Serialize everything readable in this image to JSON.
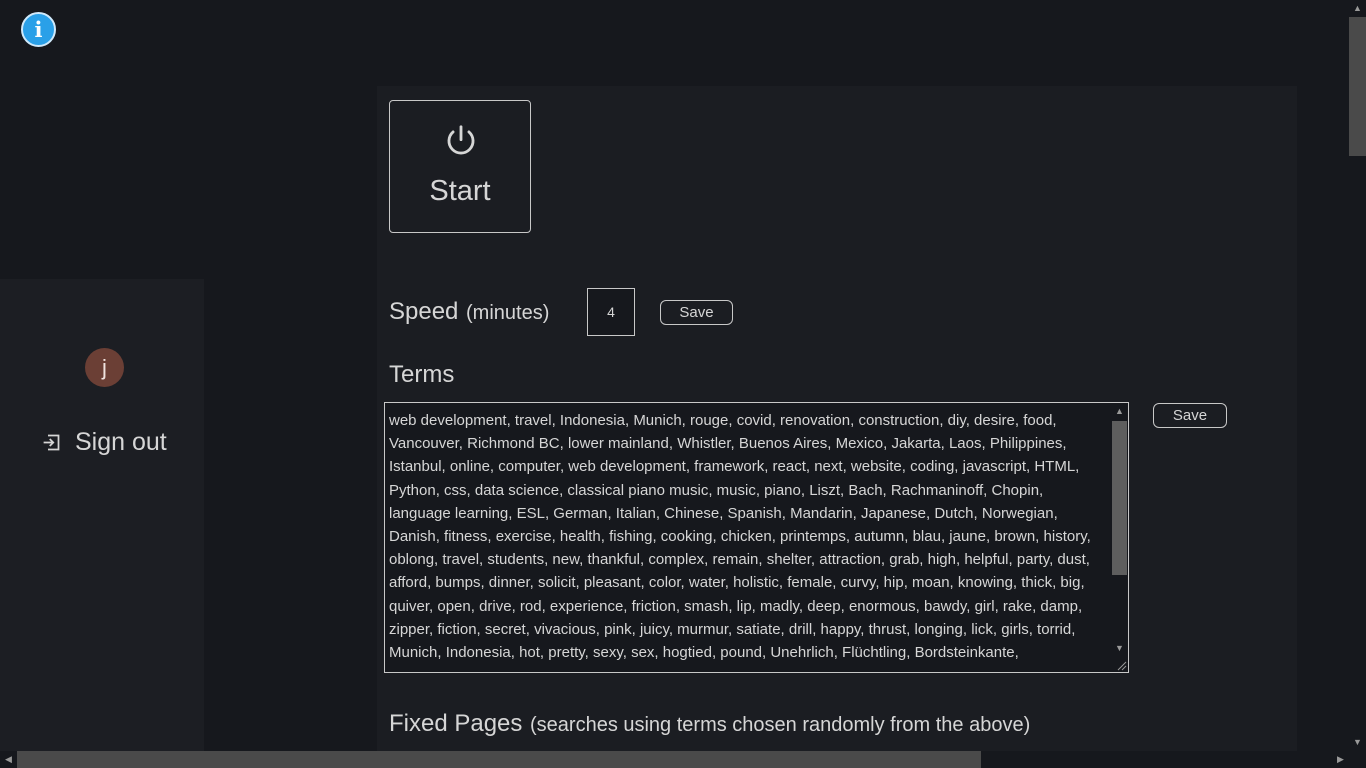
{
  "info": {
    "icon_glyph": "i",
    "icon": "info-icon",
    "color": "#2aa0e8"
  },
  "sidebar": {
    "avatar_letter": "j",
    "avatar_color": "#6b3f35",
    "signout_label": "Sign out",
    "signout_icon": "sign-out-icon"
  },
  "main": {
    "start_label": "Start",
    "start_icon": "power-icon",
    "speed": {
      "label": "Speed",
      "unit": "(minutes)",
      "value": "4",
      "save_label": "Save"
    },
    "terms": {
      "heading": "Terms",
      "save_label": "Save",
      "value": "web development, travel, Indonesia, Munich, rouge, covid, renovation, construction, diy, desire, food, Vancouver, Richmond BC, lower mainland, Whistler, Buenos Aires, Mexico, Jakarta, Laos, Philippines, Istanbul, online, computer, web development, framework, react, next, website, coding, javascript, HTML, Python, css, data science, classical piano music, music, piano, Liszt, Bach, Rachmaninoff, Chopin, language learning, ESL, German, Italian, Chinese, Spanish, Mandarin, Japanese, Dutch, Norwegian, Danish, fitness, exercise, health, fishing, cooking, chicken, printemps, autumn, blau, jaune, brown, history, oblong, travel, students, new, thankful, complex, remain, shelter, attraction, grab, high, helpful, party, dust, afford, bumps, dinner, solicit, pleasant, color, water, holistic, female, curvy, hip, moan, knowing, thick, big, quiver, open, drive, rod, experience, friction, smash, lip, madly, deep, enormous, bawdy, girl, rake, damp, zipper, fiction, secret, vivacious, pink, juicy, murmur, satiate, drill, happy, thrust, longing, lick, girls, torrid, Munich, Indonesia, hot, pretty, sexy, sex, hogtied, pound, Unehrlich, Flüchtling, Bordsteinkante,"
    },
    "fixed_pages": {
      "heading": "Fixed Pages",
      "subtitle": "(searches using terms chosen randomly from the above)"
    }
  }
}
